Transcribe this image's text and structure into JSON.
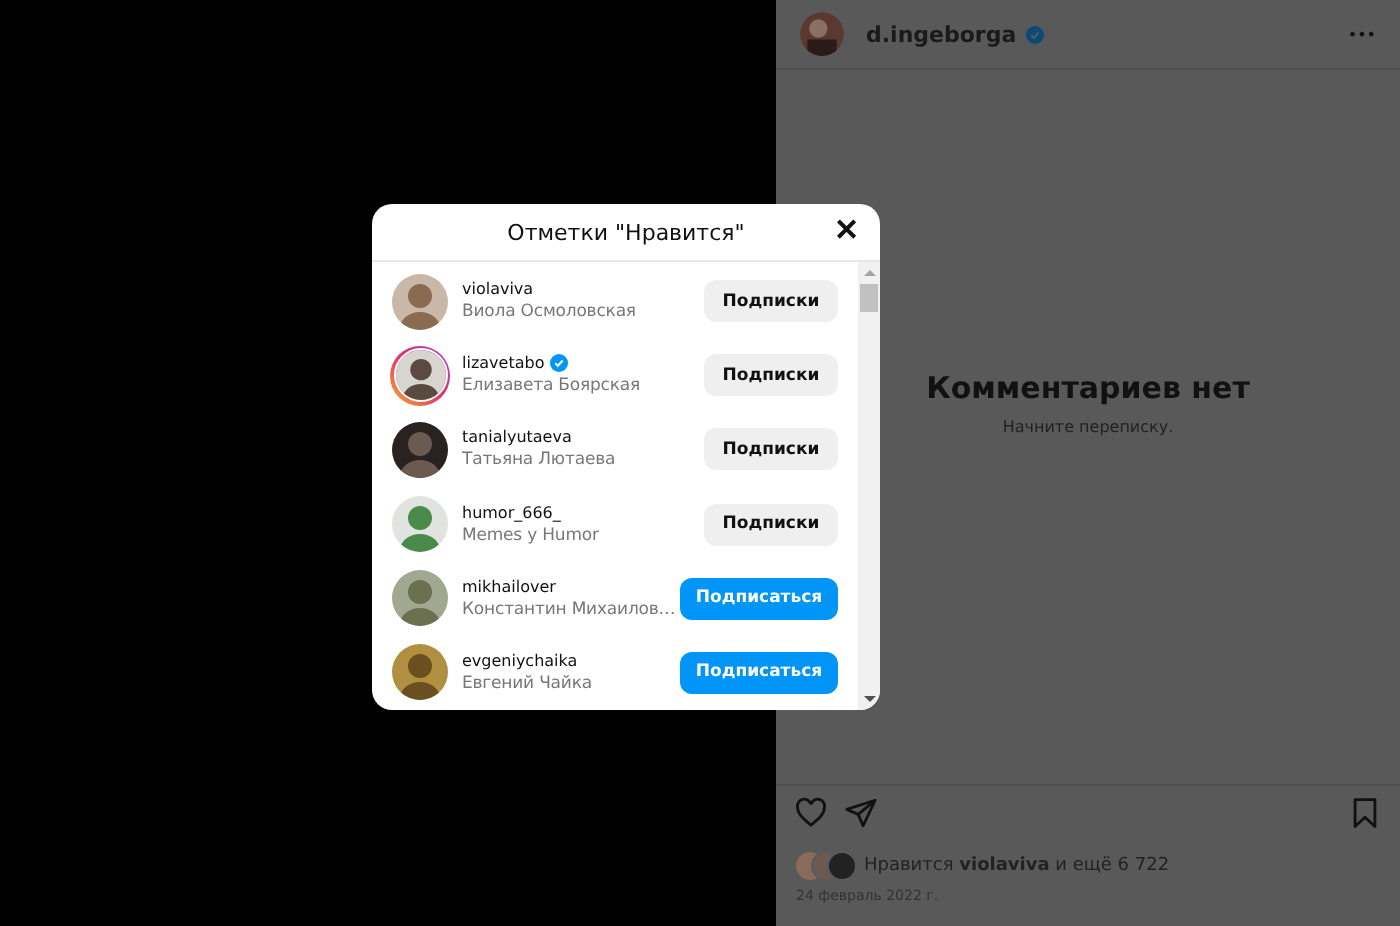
{
  "post": {
    "author": {
      "username": "d.ingeborga",
      "verified": true
    },
    "more": "•••",
    "empty_title": "Комментариев нет",
    "empty_subtitle": "Начните переписку.",
    "likes_text": "Нравится **violaviva** и ещё 6 722",
    "date": "24 февраль 2022 г."
  },
  "dialog": {
    "title": "Отметки \"Нравится\"",
    "close": "✕",
    "users": [
      {
        "username": "violaviva",
        "name": "Виола Осмоловская",
        "verified": false,
        "story": false,
        "following": true,
        "button": "Подписки"
      },
      {
        "username": "lizavetabo",
        "name": "Елизавета Боярская",
        "verified": true,
        "story": true,
        "following": true,
        "button": "Подписки"
      },
      {
        "username": "tanialyutaeva",
        "name": "Татьяна Лютаева",
        "verified": false,
        "story": false,
        "following": true,
        "button": "Подписки"
      },
      {
        "username": "humor_666_",
        "name": "Memes y Humor",
        "verified": false,
        "story": false,
        "following": true,
        "button": "Подписки"
      },
      {
        "username": "mikhailover",
        "name": "Константин Михаилов…",
        "verified": false,
        "story": false,
        "following": false,
        "button": "Подписаться"
      },
      {
        "username": "evgeniychaika",
        "name": "Евгений Чайка",
        "verified": false,
        "story": false,
        "following": false,
        "button": "Подписаться"
      }
    ]
  }
}
